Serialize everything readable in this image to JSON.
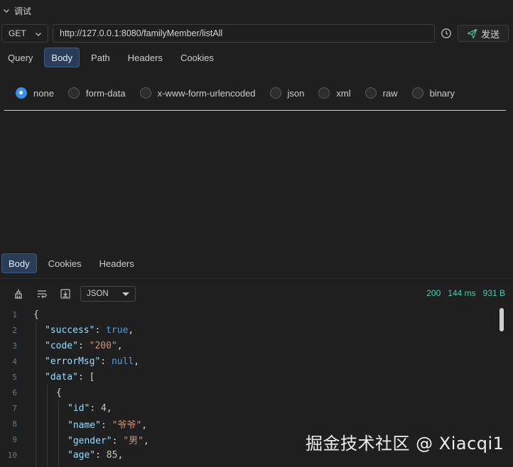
{
  "section": {
    "title": "调试"
  },
  "request": {
    "method": "GET",
    "url": "http://127.0.0.1:8080/familyMember/listAll",
    "send_label": "发送"
  },
  "tabs": [
    {
      "label": "Query",
      "active": false
    },
    {
      "label": "Body",
      "active": true
    },
    {
      "label": "Path",
      "active": false
    },
    {
      "label": "Headers",
      "active": false
    },
    {
      "label": "Cookies",
      "active": false
    }
  ],
  "body_types": [
    {
      "label": "none",
      "selected": true
    },
    {
      "label": "form-data",
      "selected": false
    },
    {
      "label": "x-www-form-urlencoded",
      "selected": false
    },
    {
      "label": "json",
      "selected": false
    },
    {
      "label": "xml",
      "selected": false
    },
    {
      "label": "raw",
      "selected": false
    },
    {
      "label": "binary",
      "selected": false
    }
  ],
  "response_tabs": [
    {
      "label": "Body",
      "active": true
    },
    {
      "label": "Cookies",
      "active": false
    },
    {
      "label": "Headers",
      "active": false
    }
  ],
  "response": {
    "format": "JSON",
    "status": "200",
    "time": "144 ms",
    "size": "931 B"
  },
  "code_lines": [
    {
      "n": "1",
      "text": "{"
    },
    {
      "n": "2",
      "text": "\"success\": true,"
    },
    {
      "n": "3",
      "text": "\"code\": \"200\","
    },
    {
      "n": "4",
      "text": "\"errorMsg\": null,"
    },
    {
      "n": "5",
      "text": "\"data\": ["
    },
    {
      "n": "6",
      "text": "{"
    },
    {
      "n": "7",
      "text": "\"id\": 4,"
    },
    {
      "n": "8",
      "text": "\"name\": \"爷爷\","
    },
    {
      "n": "9",
      "text": "\"gender\": \"男\","
    },
    {
      "n": "10",
      "text": "\"age\": 85,"
    }
  ],
  "watermark": "掘金技术社区 @ Xiacqi1",
  "colors": {
    "accent": "#3b8eea",
    "status_green": "#4ec9b0",
    "active_tab_bg": "#2a3c58",
    "json_key": "#9cdcfe",
    "json_string": "#ce9178",
    "json_keyword": "#569cd6",
    "json_number": "#b5cea8"
  },
  "icons": [
    "chevron-down-icon",
    "history-icon",
    "send-icon",
    "clear-icon",
    "wrap-icon",
    "download-icon"
  ]
}
